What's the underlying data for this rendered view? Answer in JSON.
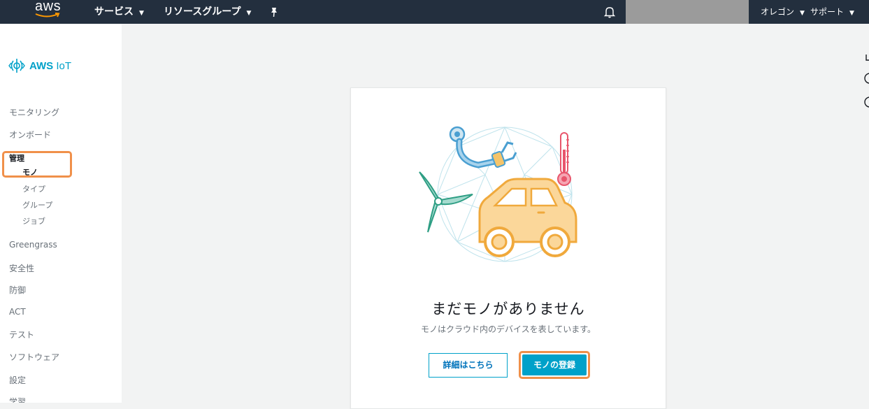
{
  "topbar": {
    "logo_text": "aws",
    "services_label": "サービス",
    "resource_groups_label": "リソースグループ",
    "region_label": "オレゴン",
    "support_label": "サポート",
    "icons": [
      "pin-icon",
      "bell-icon",
      "caret-down-icon"
    ]
  },
  "sidebar": {
    "brand": "AWS IoT",
    "brand_bold": "AWS",
    "brand_thin": "IoT",
    "items": [
      {
        "label": "モニタリング"
      },
      {
        "label": "オンボード"
      },
      {
        "label": "管理",
        "children": [
          "モノ",
          "タイプ",
          "グループ",
          "ジョブ"
        ],
        "active_child": "モノ"
      },
      {
        "label": "Greengrass"
      },
      {
        "label": "安全性"
      },
      {
        "label": "防御"
      },
      {
        "label": "ACT"
      },
      {
        "label": "テスト"
      },
      {
        "label": "ソフトウェア"
      },
      {
        "label": "設定"
      },
      {
        "label": "学習"
      }
    ]
  },
  "main": {
    "empty_state": {
      "title": "まだモノがありません",
      "description": "モノはクラウド内のデバイスを表しています。",
      "learn_more_button": "詳細はこちら",
      "register_button": "モノの登録",
      "illustration_icons": [
        "robot-arm-icon",
        "thermometer-icon",
        "wind-turbine-icon",
        "car-icon"
      ]
    }
  },
  "colors": {
    "topbar_bg": "#232f3e",
    "accent": "#00a1c9",
    "highlight": "#f0904a",
    "page_bg": "#f2f3f3"
  }
}
